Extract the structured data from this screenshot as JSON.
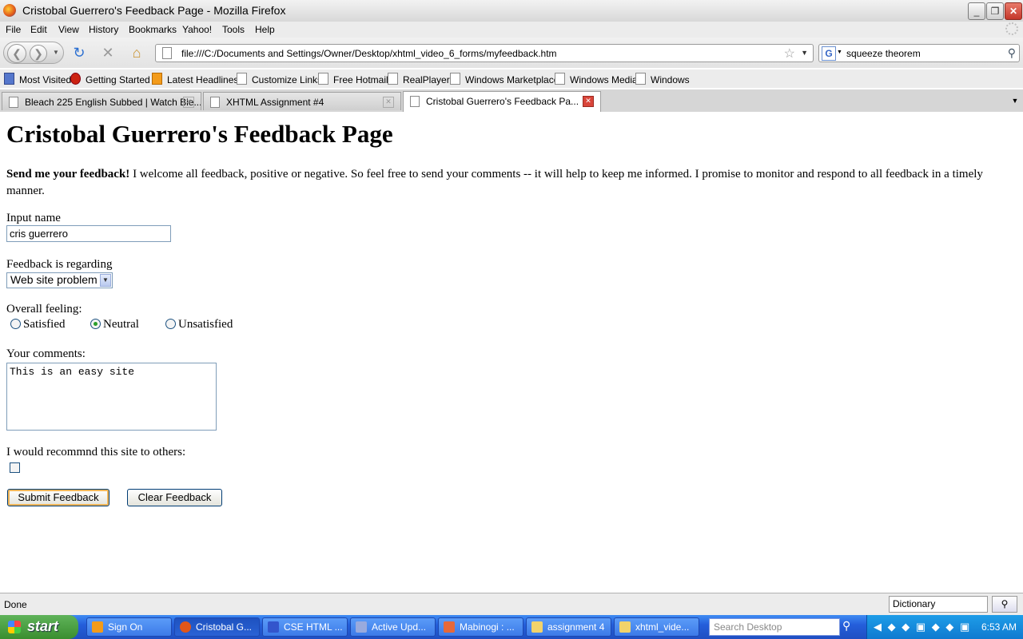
{
  "window": {
    "title": "Cristobal Guerrero's Feedback Page - Mozilla Firefox"
  },
  "menu": [
    "File",
    "Edit",
    "View",
    "History",
    "Bookmarks",
    "Yahoo!",
    "Tools",
    "Help"
  ],
  "nav": {
    "url": "file:///C:/Documents and Settings/Owner/Desktop/xhtml_video_6_forms/myfeedback.htm",
    "search_value": "squeeze theorem",
    "search_engine": "G"
  },
  "bookmarks": [
    "Most Visited",
    "Getting Started",
    "Latest Headlines",
    "Customize Links",
    "Free Hotmail",
    "RealPlayer",
    "Windows Marketplace",
    "Windows Media",
    "Windows"
  ],
  "tabs": [
    {
      "label": "Bleach 225 English Subbed | Watch Ble..."
    },
    {
      "label": "XHTML Assignment #4"
    },
    {
      "label": "Cristobal Guerrero's Feedback Pa..."
    }
  ],
  "page": {
    "heading": "Cristobal Guerrero's Feedback Page",
    "intro_bold": "Send me your feedback!",
    "intro_text": " I welcome all feedback, positive or negative. So feel free to send your comments -- it will help to keep me informed. I promise to monitor and respond to all feedback in a timely manner.",
    "name_label": "Input name",
    "name_value": "cris guerrero",
    "regarding_label": "Feedback is regarding",
    "regarding_value": "Web site problem",
    "feeling_label": "Overall feeling:",
    "feeling_options": [
      "Satisfied",
      "Neutral",
      "Unsatisfied"
    ],
    "feeling_selected": "Neutral",
    "comments_label": "Your comments:",
    "comments_value": "This is an easy site",
    "recommend_label": "I would recommnd this site to others:",
    "recommend_checked": false,
    "submit_label": "Submit Feedback",
    "clear_label": "Clear Feedback"
  },
  "status": {
    "text": "Done",
    "dictionary_placeholder": "Dictionary"
  },
  "taskbar": {
    "start_label": "start",
    "items": [
      "Sign On",
      "Cristobal G...",
      "CSE HTML ...",
      "Active Upd...",
      "Mabinogi : ...",
      "assignment 4",
      "xhtml_vide..."
    ],
    "active_index": 1,
    "search_placeholder": "Search Desktop",
    "clock": "6:53 AM"
  },
  "colors": {
    "taskbar_blue": "#245edb",
    "start_green": "#3a8e2f",
    "radio_dot": "#2a9e2a",
    "tab_close_red": "#d9453a"
  }
}
